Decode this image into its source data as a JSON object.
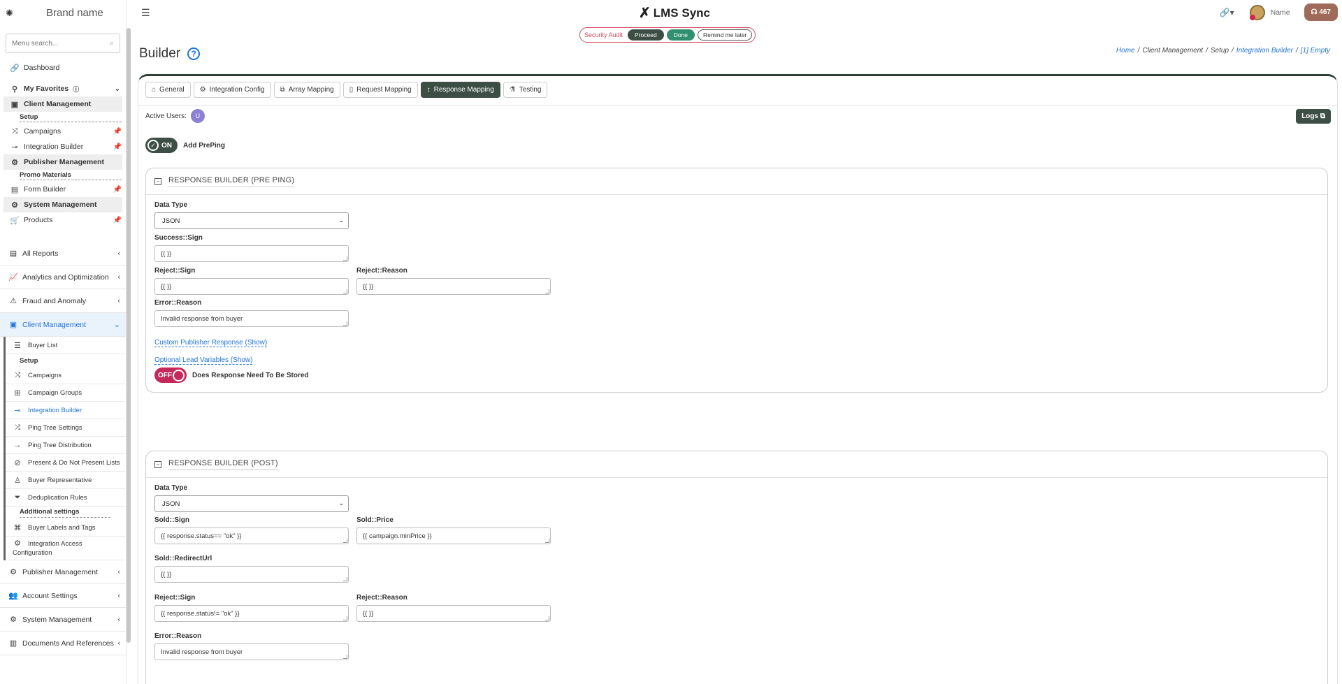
{
  "brand": "Brand name",
  "menu_search_placeholder": "Menu search...",
  "sidebar": {
    "dashboard": "Dashboard",
    "my_favorites": "My Favorites",
    "fav_client_management": "Client Management",
    "fav_setup": "Setup",
    "fav_campaigns": "Campaigns",
    "fav_integration_builder": "Integration Builder",
    "fav_publisher_management": "Publisher Management",
    "fav_promo_materials": "Promo Materials",
    "fav_form_builder": "Form Builder",
    "fav_system_management": "System Management",
    "fav_products": "Products",
    "all_reports": "All Reports",
    "analytics": "Analytics and Optimization",
    "fraud": "Fraud and Anomaly",
    "client_management": "Client Management",
    "sub": {
      "buyer_list": "Buyer List",
      "setup": "Setup",
      "campaigns": "Campaigns",
      "campaign_groups": "Campaign Groups",
      "integration_builder": "Integration Builder",
      "ping_tree_settings": "Ping Tree Settings",
      "ping_tree_distribution": "Ping Tree Distribution",
      "present_lists": "Present & Do Not Present Lists",
      "buyer_representative": "Buyer Representative",
      "dedup_rules": "Deduplication Rules",
      "additional_settings": "Additional settings",
      "buyer_labels": "Buyer Labels and Tags",
      "integration_access_1": "Integration Access",
      "integration_access_2": "Configuration"
    },
    "publisher_management": "Publisher Management",
    "account_settings": "Account Settings",
    "system_management": "System Management",
    "documents": "Documents And References"
  },
  "topbar": {
    "app_name": "LMS Sync",
    "user_name": "Name",
    "badge_count": "467"
  },
  "audit": {
    "label": "Security Audit",
    "proceed": "Proceed",
    "done": "Done",
    "remind": "Remind me later"
  },
  "page": {
    "title": "Builder",
    "breadcrumb": [
      "Home",
      "Client Management",
      "Setup",
      "Integration Builder",
      "[1] Empty"
    ]
  },
  "tabs": [
    "General",
    "Integration Config",
    "Array Mapping",
    "Request Mapping",
    "Response Mapping",
    "Testing"
  ],
  "active_users_label": "Active Users:",
  "active_user_initial": "U",
  "logs_label": "Logs",
  "preping_toggle": {
    "state": "ON",
    "label": "Add PrePing"
  },
  "pre_ping": {
    "title": "RESPONSE BUILDER (PRE PING)",
    "data_type_label": "Data Type",
    "data_type_value": "JSON",
    "success_sign_label": "Success::Sign",
    "success_sign_value": "{{ }}",
    "reject_sign_label": "Reject::Sign",
    "reject_sign_value": "{{ }}",
    "reject_reason_label": "Reject::Reason",
    "reject_reason_value": "{{ }}",
    "error_reason_label": "Error::Reason",
    "error_reason_value": "Invalid response from buyer",
    "custom_publisher_link": "Custom Publisher Response (Show)",
    "optional_vars_link": "Optional Lead Variables (Show)",
    "store_toggle_state": "OFF",
    "store_toggle_label": "Does Response Need To Be Stored"
  },
  "post": {
    "title": "RESPONSE BUILDER (POST)",
    "data_type_label": "Data Type",
    "data_type_value": "JSON",
    "sold_sign_label": "Sold::Sign",
    "sold_sign_value": "{{ response.status== \"ok\" }}",
    "sold_price_label": "Sold::Price",
    "sold_price_value": "{{ campaign.minPrice }}",
    "sold_redirect_label": "Sold::RedirectUrl",
    "sold_redirect_value": "{{ }}",
    "reject_sign_label": "Reject::Sign",
    "reject_sign_value": "{{ response.status!= \"ok\" }}",
    "reject_reason_label": "Reject::Reason",
    "reject_reason_value": "{{ }}",
    "error_reason_label": "Error::Reason",
    "error_reason_value": "Invalid response from buyer"
  }
}
